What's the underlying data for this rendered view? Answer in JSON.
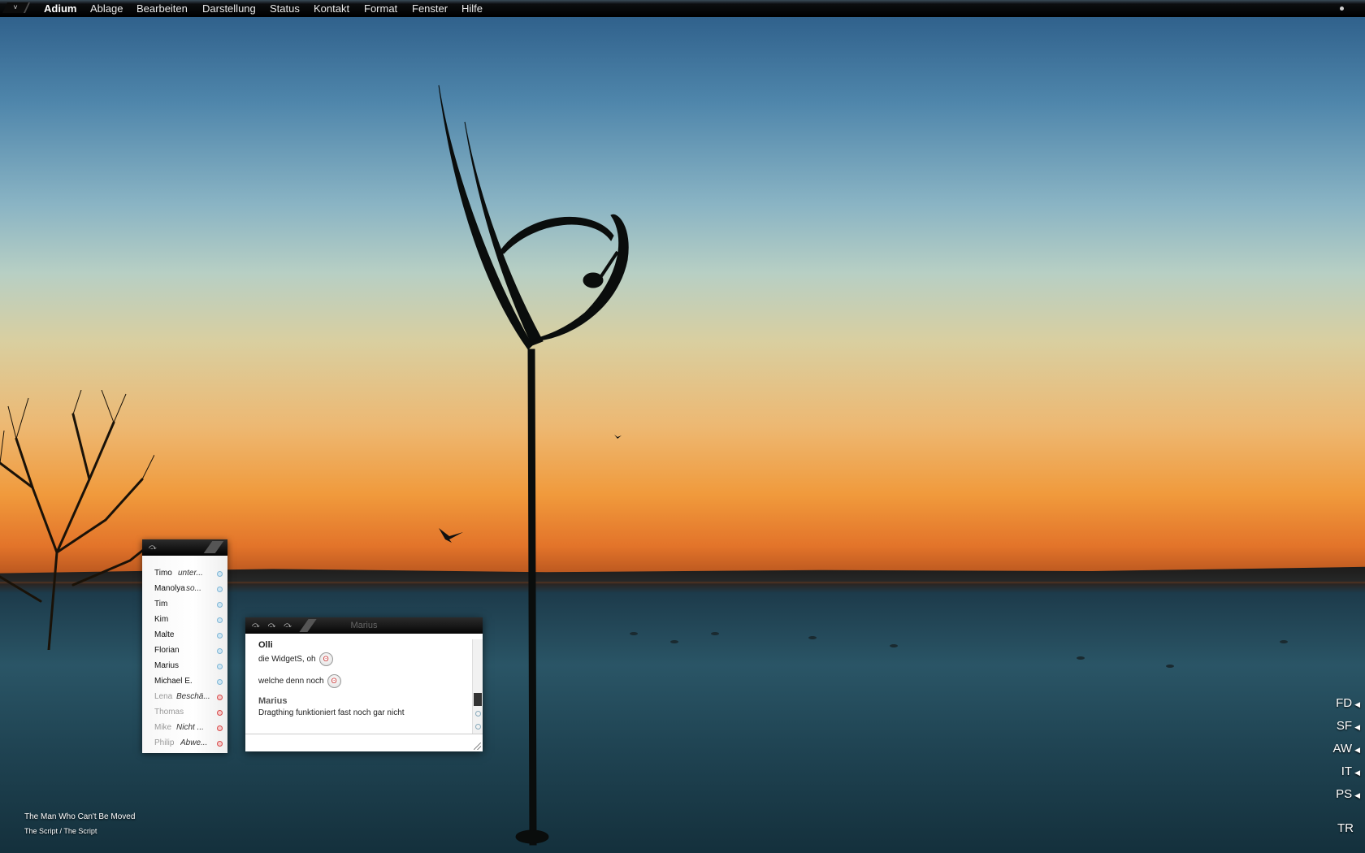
{
  "menubar": {
    "apple_glyph": "˅",
    "app": "Adium",
    "items": [
      "Ablage",
      "Bearbeiten",
      "Darstellung",
      "Status",
      "Kontakt",
      "Format",
      "Fenster",
      "Hilfe"
    ]
  },
  "contact_list": {
    "title_button": "⤼",
    "contacts": [
      {
        "name": "Timo",
        "status": "unter...",
        "state": "online"
      },
      {
        "name": "Manolya",
        "status": "so...",
        "state": "online"
      },
      {
        "name": "Tim",
        "status": "",
        "state": "online"
      },
      {
        "name": "Kim",
        "status": "",
        "state": "online"
      },
      {
        "name": "Malte",
        "status": "",
        "state": "online"
      },
      {
        "name": "Florian",
        "status": "",
        "state": "online"
      },
      {
        "name": "Marius",
        "status": "",
        "state": "online"
      },
      {
        "name": "Michael E.",
        "status": "",
        "state": "online"
      },
      {
        "name": "Lena",
        "status": "Beschä...",
        "state": "away"
      },
      {
        "name": "Thomas",
        "status": "",
        "state": "away"
      },
      {
        "name": "Mike",
        "status": "Nicht ...",
        "state": "away"
      },
      {
        "name": "Philip",
        "status": "Abwe...",
        "state": "away"
      }
    ]
  },
  "chat": {
    "buttons": "⤼⤼⤼",
    "title": "Marius",
    "messages": [
      {
        "sender": "Olli",
        "lines": [
          {
            "text": "die WidgetS, oh",
            "smiley": "ʘ"
          },
          {
            "text": "welche denn noch",
            "smiley": "ʘ"
          }
        ]
      },
      {
        "sender": "Marius",
        "lines": [
          {
            "text": "Dragthing funktioniert fast noch gar nicht",
            "smiley": ""
          }
        ]
      }
    ]
  },
  "dock": [
    "FD",
    "SF",
    "AW",
    "IT",
    "PS",
    "TR"
  ],
  "now_playing": {
    "title": "The Man Who Can't Be Moved",
    "artist_album": "The Script / The Script"
  },
  "colors": {
    "sky_top": "#2a5a86",
    "sunset": "#f09a3c",
    "water": "#1f4352"
  }
}
